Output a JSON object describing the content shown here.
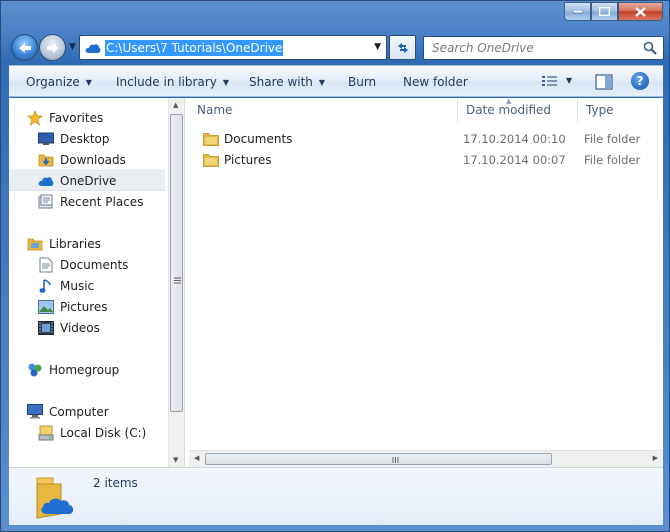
{
  "address_bar": {
    "path": "C:\\Users\\7 Tutorials\\OneDrive"
  },
  "search": {
    "placeholder": "Search OneDrive"
  },
  "toolbar": {
    "organize": "Organize",
    "include_in_library": "Include in library",
    "share_with": "Share with",
    "burn": "Burn",
    "new_folder": "New folder"
  },
  "sidebar": {
    "favorites": {
      "label": "Favorites",
      "icon": "star-icon"
    },
    "favorites_items": [
      {
        "label": "Desktop",
        "icon": "desktop-icon"
      },
      {
        "label": "Downloads",
        "icon": "downloads-icon"
      },
      {
        "label": "OneDrive",
        "icon": "onedrive-cloud-icon",
        "selected": true
      },
      {
        "label": "Recent Places",
        "icon": "recent-places-icon"
      }
    ],
    "libraries": {
      "label": "Libraries",
      "icon": "libraries-icon"
    },
    "libraries_items": [
      {
        "label": "Documents",
        "icon": "documents-icon"
      },
      {
        "label": "Music",
        "icon": "music-icon"
      },
      {
        "label": "Pictures",
        "icon": "pictures-icon"
      },
      {
        "label": "Videos",
        "icon": "videos-icon"
      }
    ],
    "homegroup": {
      "label": "Homegroup",
      "icon": "homegroup-icon"
    },
    "computer": {
      "label": "Computer",
      "icon": "computer-icon"
    },
    "computer_items": [
      {
        "label": "Local Disk (C:)",
        "icon": "disk-icon"
      }
    ]
  },
  "columns": {
    "name": "Name",
    "date_modified": "Date modified",
    "type": "Type"
  },
  "files": [
    {
      "name": "Documents",
      "date_modified": "17.10.2014 00:10",
      "type": "File folder"
    },
    {
      "name": "Pictures",
      "date_modified": "17.10.2014 00:07",
      "type": "File folder"
    }
  ],
  "details_pane": {
    "item_count": "2 items"
  },
  "colors": {
    "selection": "#3399ff",
    "frame": "#4b82c8",
    "toolbar_text": "#1e395b",
    "folder": "#e8b740"
  }
}
